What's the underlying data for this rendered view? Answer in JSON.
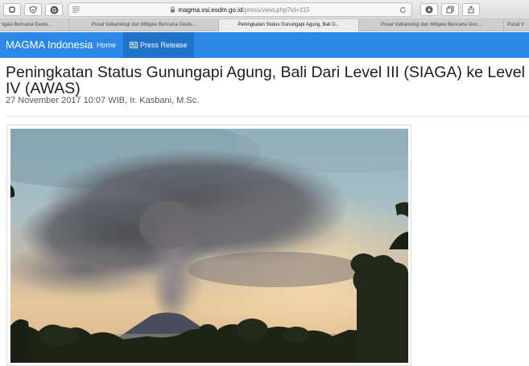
{
  "browser": {
    "url_domain": "magma.vsi.esdm.go.id",
    "url_path": "/press/view.php?id=115",
    "tabs": [
      {
        "label": "tigasi Bencana Geolo...",
        "active": false
      },
      {
        "label": "Pusat Vulkanologi dan Mitigasi Bencana Geolo...",
        "active": false
      },
      {
        "label": "Peningkatan Status Gunungapi Agung, Bali D...",
        "active": true
      },
      {
        "label": "Pusat Vulkanologi dan Mitigasi Bencana Geo...",
        "active": false
      },
      {
        "label": "Pusat V",
        "active": false
      }
    ]
  },
  "navbar": {
    "brand": "MAGMA Indonesia",
    "home": "Home",
    "press_release": "Press Release"
  },
  "article": {
    "title": "Peningkatan Status Gunungapi Agung, Bali Dari Level III (SIAGA) ke Level IV (AWAS)",
    "meta": "27 November 2017 10:07 WIB, Ir. Kasbani, M.Sc."
  },
  "icons": {
    "back": "back-icon",
    "shield": "shield-icon",
    "grammarly": "g-circle-icon",
    "reader": "lines-icon",
    "lock": "lock-icon",
    "reload": "reload-icon",
    "download": "download-icon",
    "tabs": "tabs-icon",
    "share": "share-icon",
    "press": "newspaper-icon"
  },
  "colors": {
    "navbar": "#2a89e6",
    "navbar_active": "#1f73c8"
  }
}
